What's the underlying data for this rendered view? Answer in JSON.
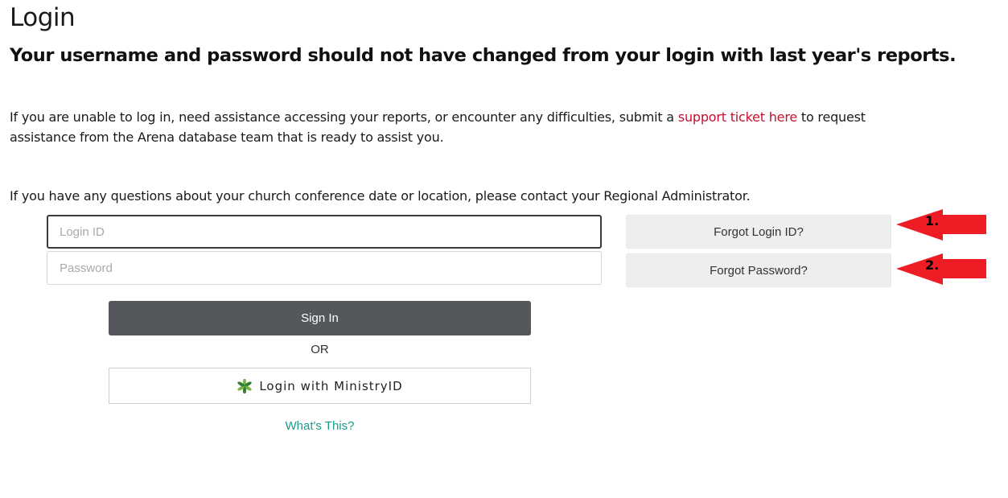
{
  "header": {
    "title": "Login",
    "subtitle": "Your username and password should not have changed from your login with last year's reports."
  },
  "info": {
    "p1_before": "If you are unable to log in, need assistance accessing your reports, or encounter any difficulties, submit a ",
    "p1_link": "support ticket here",
    "p1_after": " to request assistance from the Arena database team that is ready to assist you.",
    "p2": "If you have any questions about your church conference date or location, please contact your Regional Administrator."
  },
  "form": {
    "login_placeholder": "Login ID",
    "password_placeholder": "Password",
    "signin_label": "Sign In",
    "or_label": "OR",
    "ministry_label": "Login with MinistryID",
    "whats_this": "What's This?"
  },
  "side": {
    "forgot_login": "Forgot Login ID?",
    "forgot_password": "Forgot Password?"
  },
  "annotations": {
    "arrow1": "1.",
    "arrow2": "2.",
    "arrow_color": "#ee1c25"
  },
  "icons": {
    "ministry": "ministryid-leaf-icon"
  },
  "colors": {
    "link": "#c8102e",
    "signin_bg": "#54575b",
    "whats_this": "#1a9c8b",
    "side_button_bg": "#eeeeee"
  }
}
